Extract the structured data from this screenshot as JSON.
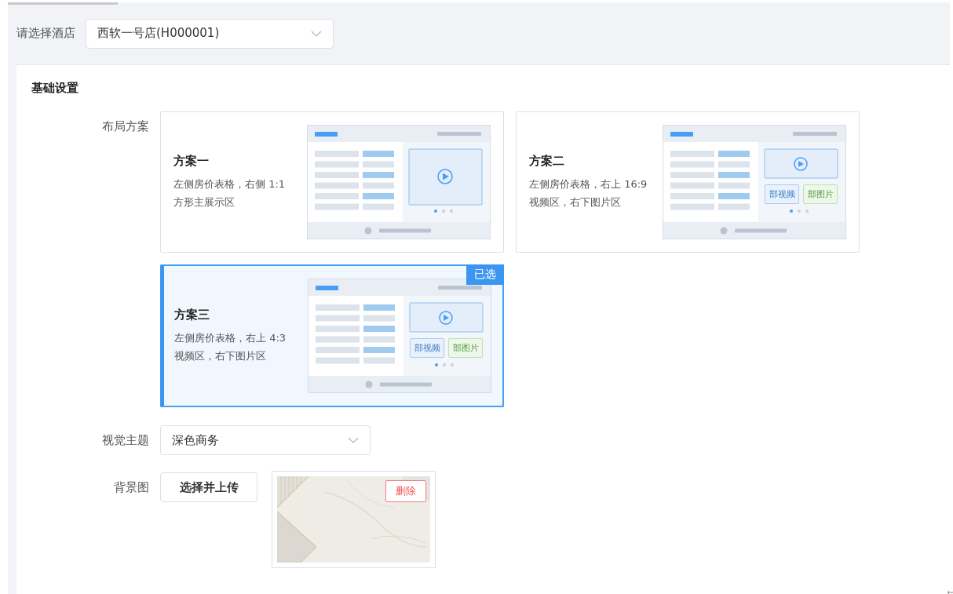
{
  "hotel_select": {
    "label": "请选择酒店",
    "value": "西软一号店(H000001)"
  },
  "section": {
    "title": "基础设置"
  },
  "layout_field": {
    "label": "布局方案",
    "selected_badge": "已选",
    "plans": [
      {
        "title": "方案一",
        "description": "左侧房价表格，右侧 1:1 方形主展示区",
        "kind": "square",
        "selected": false
      },
      {
        "title": "方案二",
        "description": "左侧房价表格，右上 16:9 视频区，右下图片区",
        "kind": "split",
        "tiles": [
          "部视频",
          "部图片"
        ],
        "selected": false
      },
      {
        "title": "方案三",
        "description": "左侧房价表格，右上 4:3 视频区，右下图片区",
        "kind": "split",
        "tiles": [
          "部视频",
          "部图片"
        ],
        "selected": true
      }
    ]
  },
  "theme_field": {
    "label": "视觉主题",
    "value": "深色商务"
  },
  "background_field": {
    "label": "背景图",
    "upload_button": "选择并上传",
    "delete_button": "删除"
  }
}
